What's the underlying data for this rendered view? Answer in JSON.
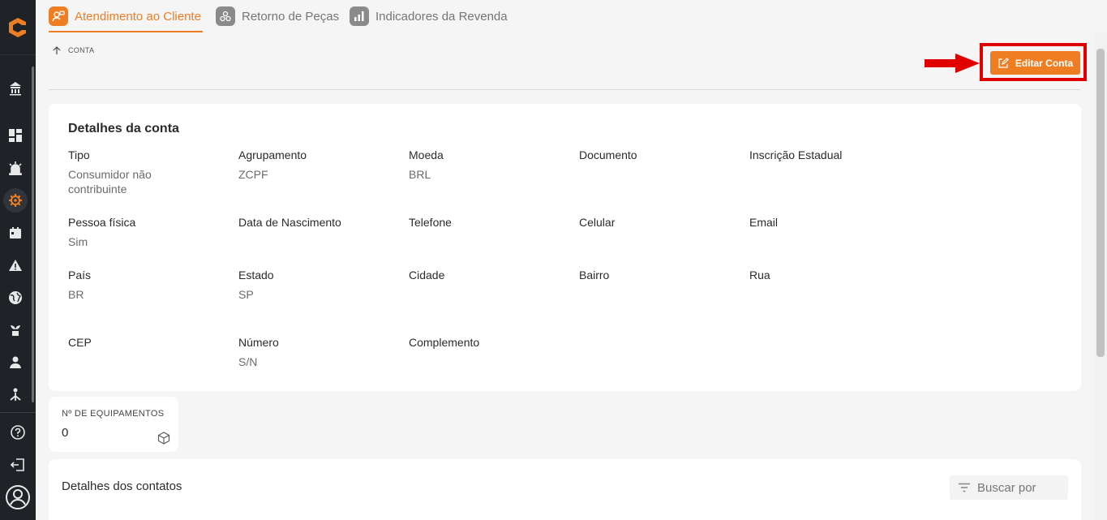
{
  "tabs": [
    {
      "label": "Atendimento ao Cliente"
    },
    {
      "label": "Retorno de Peças"
    },
    {
      "label": "Indicadores da Revenda"
    }
  ],
  "breadcrumb": {
    "label": "CONTA"
  },
  "edit_button": {
    "label": "Editar Conta"
  },
  "account": {
    "title": "Detalhes da conta",
    "fields": [
      {
        "label": "Tipo",
        "value": "Consumidor não contribuinte"
      },
      {
        "label": "Agrupamento",
        "value": "ZCPF"
      },
      {
        "label": "Moeda",
        "value": "BRL"
      },
      {
        "label": "Documento",
        "value": ""
      },
      {
        "label": "Inscrição Estadual",
        "value": ""
      },
      {
        "label": "Pessoa física",
        "value": "Sim"
      },
      {
        "label": "Data de Nascimento",
        "value": ""
      },
      {
        "label": "Telefone",
        "value": ""
      },
      {
        "label": "Celular",
        "value": ""
      },
      {
        "label": "Email",
        "value": ""
      },
      {
        "label": "País",
        "value": "BR"
      },
      {
        "label": "Estado",
        "value": "SP"
      },
      {
        "label": "Cidade",
        "value": ""
      },
      {
        "label": "Bairro",
        "value": ""
      },
      {
        "label": "Rua",
        "value": ""
      },
      {
        "label": "CEP",
        "value": ""
      },
      {
        "label": "Número",
        "value": "S/N"
      },
      {
        "label": "Complemento",
        "value": ""
      }
    ]
  },
  "equipment": {
    "label": "Nº DE EQUIPAMENTOS",
    "value": "0"
  },
  "contacts": {
    "title": "Detalhes dos contatos",
    "search_placeholder": "Buscar por"
  },
  "colors": {
    "accent": "#ef7d22",
    "sidebar": "#1f2328",
    "highlight": "#e00000"
  }
}
